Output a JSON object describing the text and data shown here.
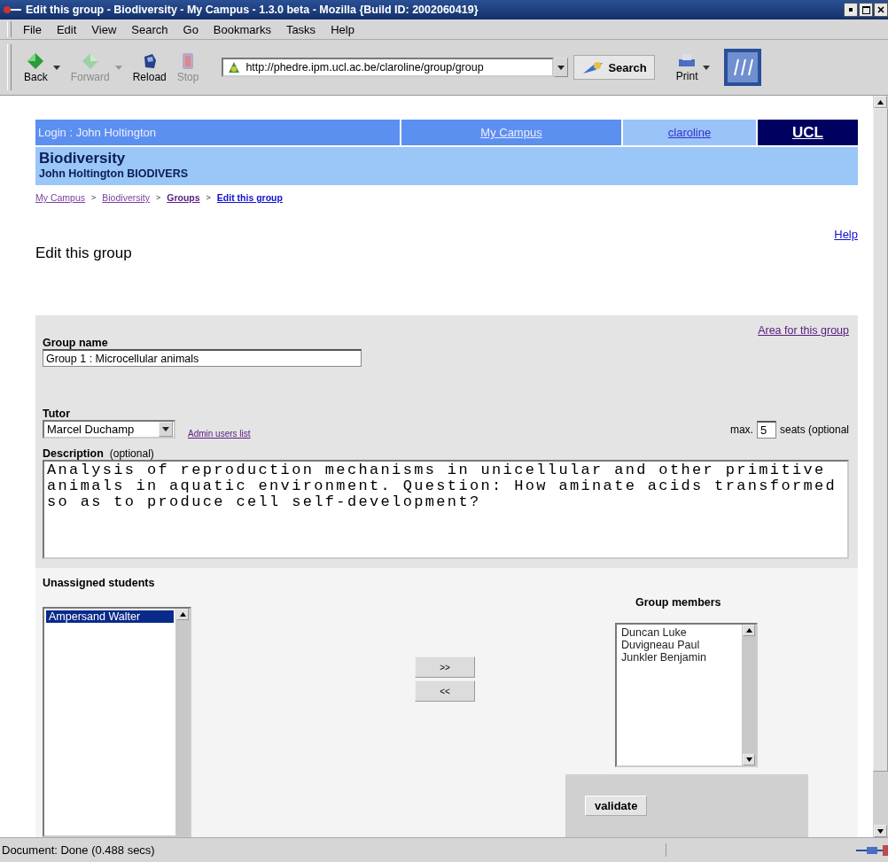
{
  "window": {
    "title": "Edit this group - Biodiversity - My Campus - 1.3.0 beta - Mozilla {Build ID: 2002060419}"
  },
  "menu": [
    "File",
    "Edit",
    "View",
    "Search",
    "Go",
    "Bookmarks",
    "Tasks",
    "Help"
  ],
  "toolbar": [
    {
      "label": "Back",
      "kind": "back",
      "disabled": false,
      "caret": true
    },
    {
      "label": "Forward",
      "kind": "forward",
      "disabled": true,
      "caret": true
    },
    {
      "label": "Reload",
      "kind": "reload",
      "disabled": false,
      "caret": false
    },
    {
      "label": "Stop",
      "kind": "stop",
      "disabled": true,
      "caret": false
    }
  ],
  "address": "http://phedre.ipm.ucl.ac.be/claroline/group/group",
  "search_button": "Search",
  "print_button": "Print",
  "top_bar": {
    "login": "Login : John Holtington",
    "links": [
      {
        "label": "My Campus",
        "kind": "campus"
      },
      {
        "label": "claroline",
        "kind": "claroline"
      },
      {
        "label": "UCL",
        "kind": "ucl"
      }
    ]
  },
  "course": {
    "title": "Biodiversity",
    "subtitle": "John Holtington BIODIVERS"
  },
  "breadcrumb": [
    {
      "label": "My Campus",
      "kind": "visited"
    },
    {
      "label": "Biodiversity",
      "kind": "visited"
    },
    {
      "label": "Groups",
      "kind": "section"
    },
    {
      "label": "Edit this group",
      "kind": "current"
    }
  ],
  "breadcrumb_separator": ">",
  "help_link": "Help",
  "heading": "Edit this group",
  "form": {
    "area_link": "Area for this group",
    "group_name_label": "Group name",
    "group_name": "Group 1 : Microcellular animals",
    "tutor_label": "Tutor",
    "tutor": "Marcel Duchamp",
    "admin_link": "Admin users list",
    "max_label": "max.",
    "seats": "5",
    "seats_label": "seats (optional",
    "description_label": "Description",
    "description_hint": "(optional)",
    "description": "Analysis of reproduction mechanisms in unicellular and other primitive animals in aquatic environment. Question: How aminate acids transformed so as to produce cell self-development?"
  },
  "unassigned": {
    "label": "Unassigned students",
    "items": [
      {
        "name": "Ampersand Walter",
        "selected": true
      }
    ]
  },
  "move_buttons": [
    ">>",
    "<<"
  ],
  "members": {
    "label": "Group members",
    "items": [
      {
        "name": "Duncan Luke",
        "selected": false
      },
      {
        "name": "Duvigneau Paul",
        "selected": false
      },
      {
        "name": "Junkler Benjamin",
        "selected": false
      }
    ]
  },
  "validate_button": "validate",
  "status": "Document: Done (0.488 secs)"
}
